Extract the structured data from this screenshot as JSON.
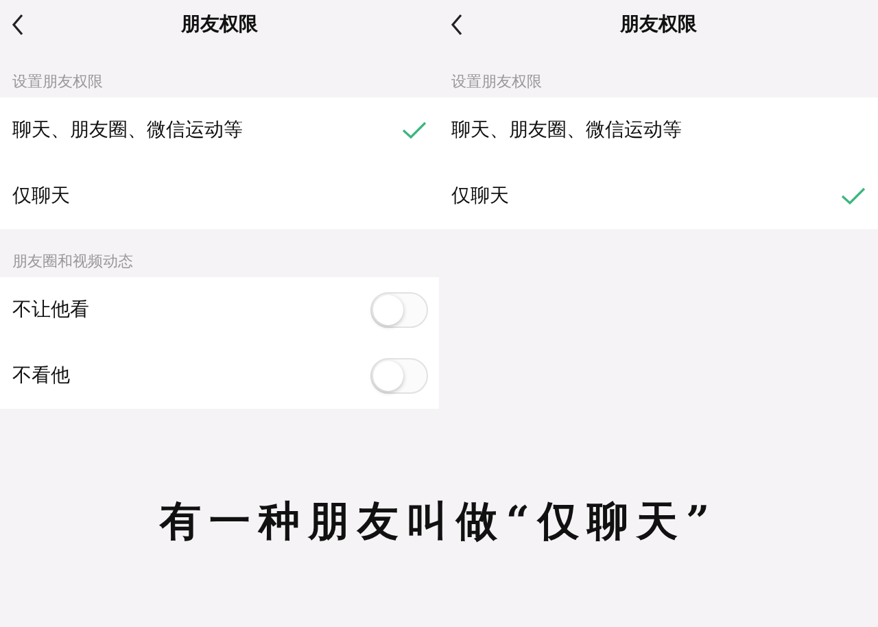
{
  "panels": [
    {
      "title": "朋友权限",
      "sections": [
        {
          "label": "设置朋友权限",
          "items": [
            {
              "kind": "option",
              "label": "聊天、朋友圈、微信运动等",
              "selected": true
            },
            {
              "kind": "option",
              "label": "仅聊天",
              "selected": false
            }
          ]
        },
        {
          "label": "朋友圈和视频动态",
          "items": [
            {
              "kind": "toggle",
              "label": "不让他看",
              "on": false
            },
            {
              "kind": "toggle",
              "label": "不看他",
              "on": false
            }
          ]
        }
      ]
    },
    {
      "title": "朋友权限",
      "sections": [
        {
          "label": "设置朋友权限",
          "items": [
            {
              "kind": "option",
              "label": "聊天、朋友圈、微信运动等",
              "selected": false
            },
            {
              "kind": "option",
              "label": "仅聊天",
              "selected": true
            }
          ]
        }
      ]
    }
  ],
  "caption": "有一种朋友叫做“仅聊天”"
}
